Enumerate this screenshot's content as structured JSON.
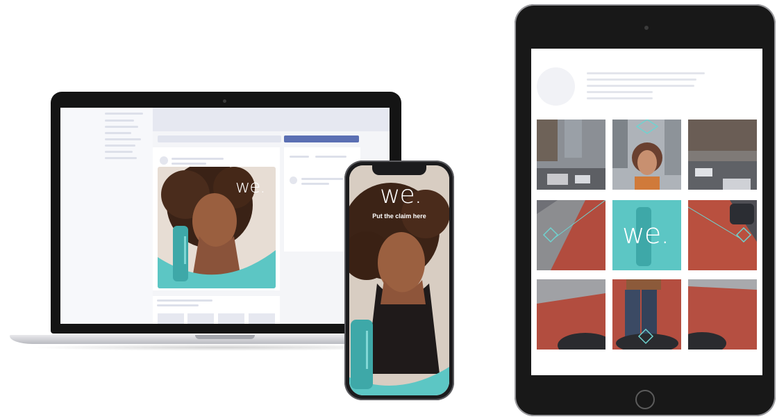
{
  "brand": {
    "logo_text": "we.",
    "claim": "Put the claim here",
    "accent_color": "#5cc6c4",
    "ui_blue": "#5b6fb3"
  },
  "devices": [
    "laptop",
    "phone",
    "tablet"
  ]
}
